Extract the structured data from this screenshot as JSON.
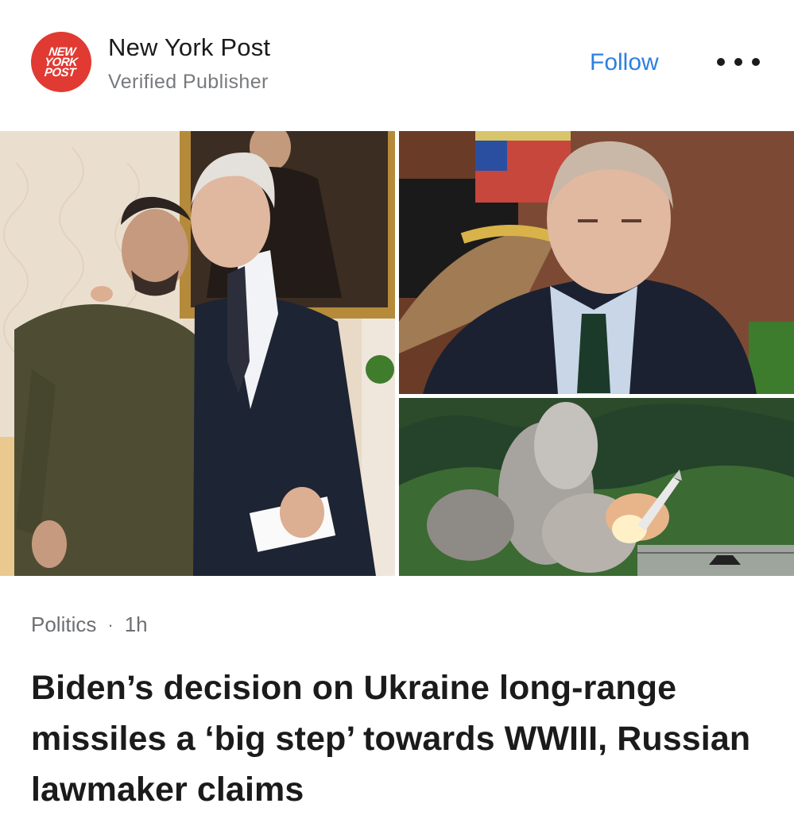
{
  "publisher": {
    "logo_lines": [
      "NEW",
      "YORK",
      "POST"
    ],
    "name": "New York Post",
    "subtitle": "Verified Publisher",
    "follow_label": "Follow",
    "more_icon": "more-horizontal-icon"
  },
  "images": [
    {
      "name": "zelensky-biden-photo"
    },
    {
      "name": "putin-photo"
    },
    {
      "name": "missile-launch-photo"
    }
  ],
  "article": {
    "category": "Politics",
    "separator": "·",
    "time": "1h",
    "headline": "Biden’s decision on Ukraine long-range missiles a ‘big step’ towards WWIII, Russian lawmaker claims"
  },
  "colors": {
    "logo_red": "#e03a33",
    "follow_blue": "#2f7fe0",
    "text_dark": "#1b1b1b",
    "text_muted": "#777a7e"
  }
}
